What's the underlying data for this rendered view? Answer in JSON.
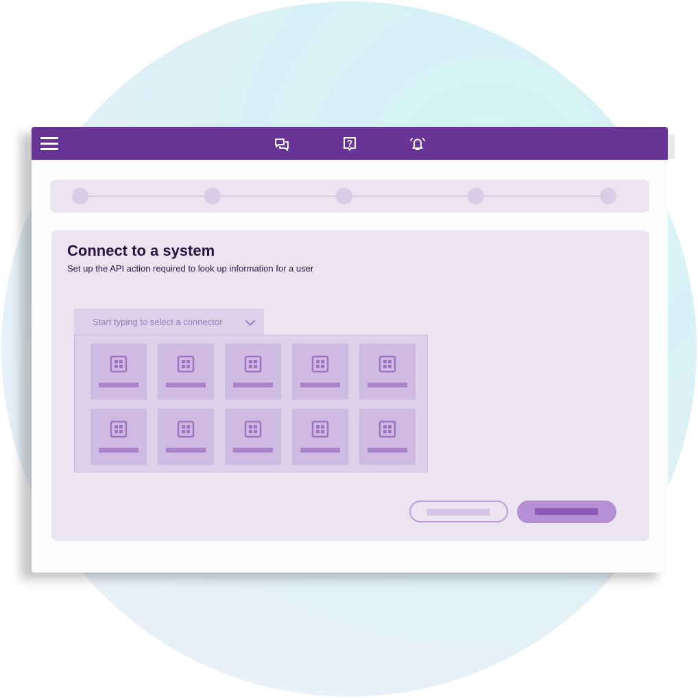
{
  "header": {
    "icons": [
      "hamburger-menu-icon",
      "chat-icon",
      "help-icon",
      "notification-bell-icon"
    ]
  },
  "stepper": {
    "total_steps": 5
  },
  "page": {
    "title": "Connect to a system",
    "subtitle": "Set up the API action required to look up information for a user"
  },
  "connector_select": {
    "placeholder": "Start typing to select a connector",
    "tile_icon": "grid-app-icon",
    "tile_count": 10
  },
  "colors": {
    "header": "#6a3396",
    "panel": "#ebe5f1",
    "primary_button": "#b48fd4",
    "secondary_button_border": "#b99bd7"
  }
}
